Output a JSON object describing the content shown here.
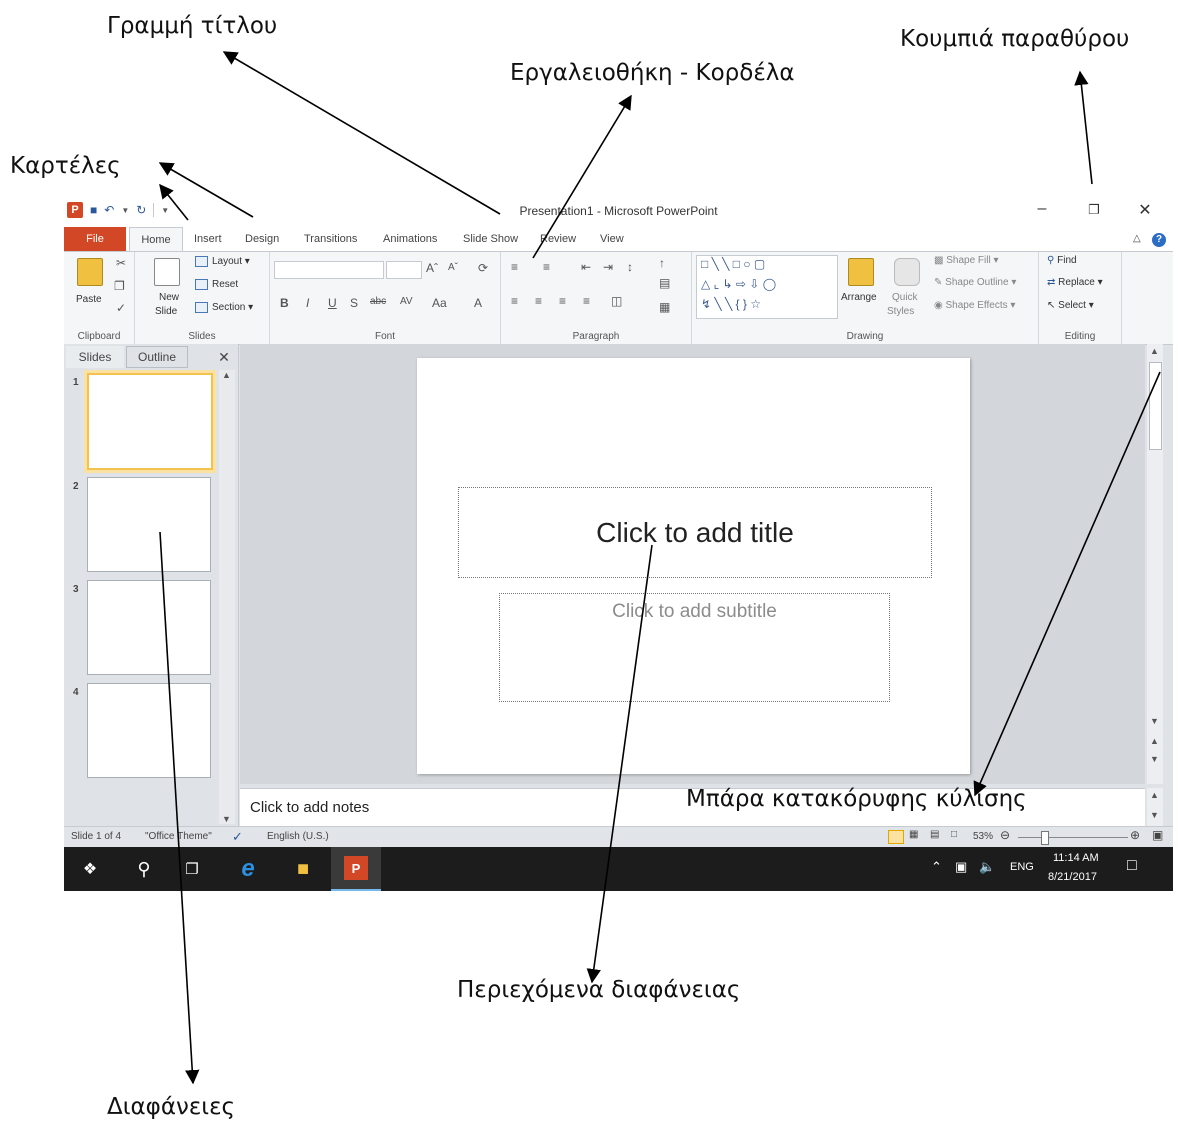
{
  "annotations": {
    "title_bar": "Γραμμή τίτλου",
    "window_buttons": "Κουμπιά παραθύρου",
    "ribbon": "Εργαλειοθήκη - Κορδέλα",
    "tabs": "Καρτέλες",
    "scrollbar": "Μπάρα κατακόρυφης κύλισης",
    "slide_content": "Περιεχόμενα διαφάνειας",
    "slides": "Διαφάνειες"
  },
  "window": {
    "title": "Presentation1 - Microsoft PowerPoint",
    "app_icon": "P"
  },
  "tabs": [
    "File",
    "Home",
    "Insert",
    "Design",
    "Transitions",
    "Animations",
    "Slide Show",
    "Review",
    "View"
  ],
  "ribbon": {
    "clipboard": {
      "label": "Clipboard",
      "paste": "Paste"
    },
    "slides": {
      "label": "Slides",
      "new_slide_1": "New",
      "new_slide_2": "Slide",
      "layout": "Layout",
      "reset": "Reset",
      "section": "Section"
    },
    "font": {
      "label": "Font"
    },
    "paragraph": {
      "label": "Paragraph"
    },
    "drawing": {
      "label": "Drawing",
      "arrange": "Arrange",
      "quick_1": "Quick",
      "quick_2": "Styles",
      "shape_fill": "Shape Fill",
      "shape_outline": "Shape Outline",
      "shape_effects": "Shape Effects"
    },
    "editing": {
      "label": "Editing",
      "find": "Find",
      "replace": "Replace",
      "select": "Select"
    }
  },
  "panel": {
    "tab_slides": "Slides",
    "tab_outline": "Outline",
    "thumbs": [
      "1",
      "2",
      "3",
      "4"
    ]
  },
  "slide": {
    "title_placeholder": "Click to add title",
    "subtitle_placeholder": "Click to add subtitle"
  },
  "notes": {
    "placeholder": "Click to add notes"
  },
  "status": {
    "slide_info": "Slide 1 of 4",
    "theme": "\"Office Theme\"",
    "language": "English (U.S.)",
    "zoom": "53%"
  },
  "taskbar": {
    "lang": "ENG",
    "time": "11:14 AM",
    "date": "8/21/2017"
  },
  "colors": {
    "file_tab": "#d24726",
    "selected_thumb": "#f2c14e",
    "taskbar": "#1c1c1c"
  }
}
